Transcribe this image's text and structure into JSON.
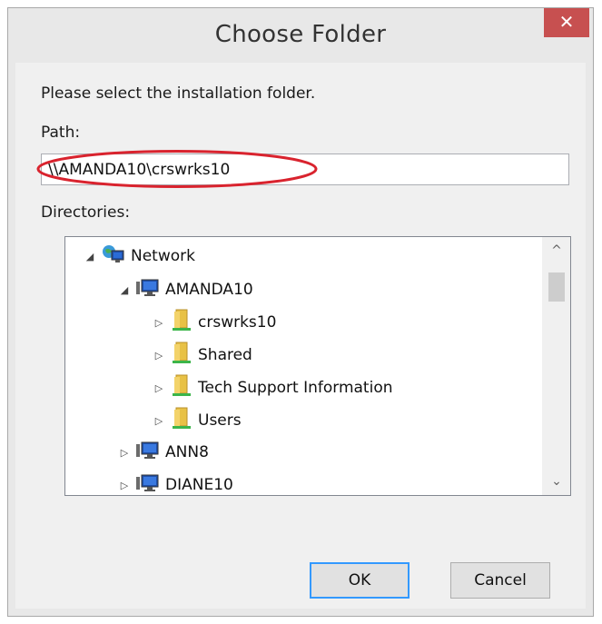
{
  "dialog": {
    "title": "Choose Folder",
    "close_glyph": "✕",
    "instruction": "Please select the installation folder.",
    "path_label": "Path:",
    "path_value": "\\\\AMANDA10\\crswrks10",
    "directories_label": "Directories:",
    "ok_label": "OK",
    "cancel_label": "Cancel"
  },
  "tree": {
    "nodes": [
      {
        "label": "Network",
        "expanded": true,
        "icon": "network-icon"
      },
      {
        "label": "AMANDA10",
        "expanded": true,
        "icon": "computer-icon"
      },
      {
        "label": "crswrks10",
        "expanded": false,
        "icon": "shared-folder-icon"
      },
      {
        "label": "Shared",
        "expanded": false,
        "icon": "shared-folder-icon"
      },
      {
        "label": "Tech Support Information",
        "expanded": false,
        "icon": "shared-folder-icon"
      },
      {
        "label": "Users",
        "expanded": false,
        "icon": "shared-folder-icon"
      },
      {
        "label": "ANN8",
        "expanded": false,
        "icon": "computer-icon"
      },
      {
        "label": "DIANE10",
        "expanded": false,
        "icon": "computer-icon"
      }
    ]
  },
  "scroll": {
    "up_glyph": "^",
    "down_glyph": "⌄"
  },
  "colors": {
    "close": "#c75050",
    "highlight_oval": "#d9232e",
    "folder": "#e8c145",
    "accent": "#3399ff"
  }
}
